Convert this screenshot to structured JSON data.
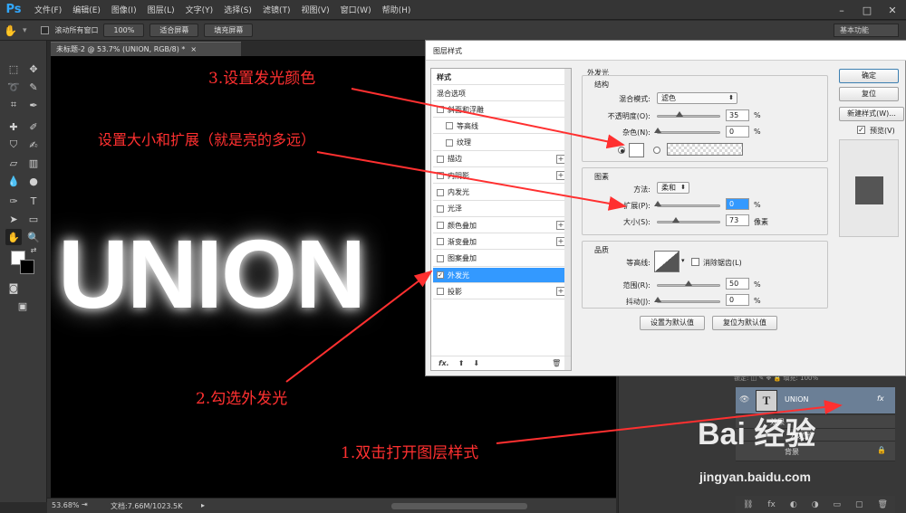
{
  "app": {
    "logo": "Ps",
    "menu": [
      "文件(F)",
      "编辑(E)",
      "图像(I)",
      "图层(L)",
      "文字(Y)",
      "选择(S)",
      "滤镜(T)",
      "视图(V)",
      "窗口(W)",
      "帮助(H)"
    ],
    "window_controls": [
      "–",
      "□",
      "✕"
    ]
  },
  "options_bar": {
    "scroll_all": "滚动所有窗口",
    "zoom_100": "100%",
    "fit_screen": "适合屏幕",
    "fill_screen": "填充屏幕",
    "workspace": "基本功能"
  },
  "document": {
    "tab_title": "未标题-2 @ 53.7% (UNION, RGB/8) *",
    "tab_close": "×",
    "canvas_text": "UNION",
    "zoom": "53.68%",
    "doc_size": "文档:7.66M/1023.5K"
  },
  "layers": {
    "top_row": "锁定: ◫ ✎ ✥ 🔒   填充: 100%",
    "text_layer_icon": "T",
    "layer_name": "UNION",
    "fx_badge": "fx",
    "effects_label": "效果",
    "effect_item": "外发光",
    "background_label": "背景",
    "footer_icons": [
      "⛓",
      "fx",
      "◐",
      "◑",
      "▭",
      "▢",
      "🗑"
    ]
  },
  "dialog": {
    "title": "图层样式",
    "styles_header": "样式",
    "blend_options": "混合选项",
    "styles": [
      {
        "label": "斜面和浮雕",
        "checked": false,
        "plus": false,
        "selected": false,
        "sub": false
      },
      {
        "label": "等高线",
        "checked": false,
        "plus": false,
        "selected": false,
        "sub": true
      },
      {
        "label": "纹理",
        "checked": false,
        "plus": false,
        "selected": false,
        "sub": true
      },
      {
        "label": "描边",
        "checked": false,
        "plus": true,
        "selected": false,
        "sub": false
      },
      {
        "label": "内阴影",
        "checked": false,
        "plus": true,
        "selected": false,
        "sub": false
      },
      {
        "label": "内发光",
        "checked": false,
        "plus": false,
        "selected": false,
        "sub": false
      },
      {
        "label": "光泽",
        "checked": false,
        "plus": false,
        "selected": false,
        "sub": false
      },
      {
        "label": "颜色叠加",
        "checked": false,
        "plus": true,
        "selected": false,
        "sub": false
      },
      {
        "label": "渐变叠加",
        "checked": false,
        "plus": true,
        "selected": false,
        "sub": false
      },
      {
        "label": "图案叠加",
        "checked": false,
        "plus": false,
        "selected": false,
        "sub": false
      },
      {
        "label": "外发光",
        "checked": true,
        "plus": false,
        "selected": true,
        "sub": false
      },
      {
        "label": "投影",
        "checked": false,
        "plus": true,
        "selected": false,
        "sub": false
      }
    ],
    "list_footer": [
      "fx.",
      "⬆",
      "⬇",
      "🗑"
    ],
    "section_title": "外发光",
    "structure": {
      "title": "结构",
      "blend_mode_label": "混合模式:",
      "blend_mode_value": "滤色",
      "opacity_label": "不透明度(O):",
      "opacity_value": "35",
      "opacity_level": 35,
      "noise_label": "杂色(N):",
      "noise_value": "0",
      "noise_level": 0,
      "percent": "%",
      "glow_color": "#ffffff"
    },
    "elements": {
      "title": "图素",
      "method_label": "方法:",
      "method_value": "柔和",
      "spread_label": "扩展(P):",
      "spread_value": "0",
      "spread_level": 0,
      "size_label": "大小(S):",
      "size_value": "73",
      "size_level": 29,
      "px": "像素"
    },
    "quality": {
      "title": "品质",
      "contour_label": "等高线:",
      "antialias_label": "消除锯齿(L)",
      "range_label": "范围(R):",
      "range_value": "50",
      "range_level": 50,
      "jitter_label": "抖动(J):",
      "jitter_value": "0",
      "jitter_level": 0
    },
    "set_default": "设置为默认值",
    "reset_default": "复位为默认值",
    "ok": "确定",
    "reset": "复位",
    "new_style": "新建样式(W)...",
    "preview_label": "预览(V)",
    "preview_checked": true
  },
  "annotations": {
    "step3": "3.设置发光颜色",
    "size_spread": "设置大小和扩展（就是亮的多远）",
    "step2": "2.勾选外发光",
    "step1": "1.双击打开图层样式",
    "color": "#ff3030"
  },
  "watermark": {
    "logo": "Bai 经验",
    "url": "jingyan.baidu.com"
  }
}
